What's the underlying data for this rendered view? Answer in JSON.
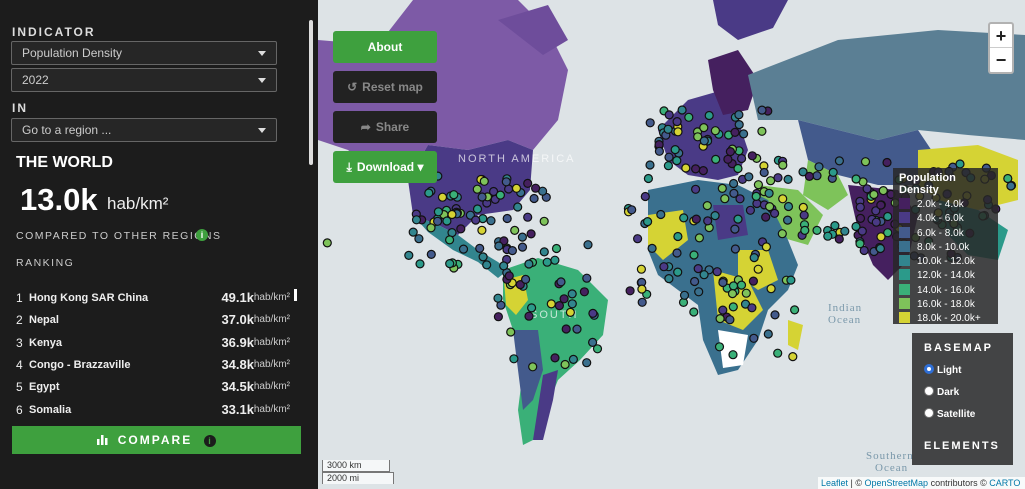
{
  "sidebar": {
    "indicator_label": "INDICATOR",
    "indicator_value": "Population Density",
    "year_value": "2022",
    "in_label": "IN",
    "region_value": "Go to a region ...",
    "region_title": "THE WORLD",
    "region_value_number": "13.0k",
    "region_value_unit": "hab/km²",
    "compared_label": "COMPARED TO OTHER REGIONS",
    "ranking_label": "RANKING",
    "ranking": [
      {
        "rank": "1",
        "name": "Hong Kong SAR China",
        "value": "49.1k",
        "unit": "hab/km²"
      },
      {
        "rank": "2",
        "name": "Nepal",
        "value": "37.0k",
        "unit": "hab/km²"
      },
      {
        "rank": "3",
        "name": "Kenya",
        "value": "36.9k",
        "unit": "hab/km²"
      },
      {
        "rank": "4",
        "name": "Congo - Brazzaville",
        "value": "34.8k",
        "unit": "hab/km²"
      },
      {
        "rank": "5",
        "name": "Egypt",
        "value": "34.5k",
        "unit": "hab/km²"
      },
      {
        "rank": "6",
        "name": "Somalia",
        "value": "33.1k",
        "unit": "hab/km²"
      }
    ],
    "compare_label": "COMPARE"
  },
  "map": {
    "buttons": {
      "about": "About",
      "reset": "Reset map",
      "share": "Share",
      "download": "Download"
    },
    "zoom_in": "+",
    "zoom_out": "−",
    "legend": {
      "title": "Population Density",
      "items": [
        {
          "label": "2.0k - 4.0k",
          "color": "#45205f"
        },
        {
          "label": "4.0k - 6.0k",
          "color": "#4a3a86"
        },
        {
          "label": "6.0k - 8.0k",
          "color": "#435a8c"
        },
        {
          "label": "8.0k - 10.0k",
          "color": "#3a708e"
        },
        {
          "label": "10.0k - 12.0k",
          "color": "#32858e"
        },
        {
          "label": "12.0k - 14.0k",
          "color": "#2b9a8a"
        },
        {
          "label": "14.0k - 16.0k",
          "color": "#3ab078"
        },
        {
          "label": "16.0k - 18.0k",
          "color": "#7ec35a"
        },
        {
          "label": "18.0k - 20.0k+",
          "color": "#d5d334"
        }
      ]
    },
    "basemap": {
      "title": "BASEMAP",
      "options": [
        {
          "label": "Light",
          "selected": true
        },
        {
          "label": "Dark",
          "selected": false
        },
        {
          "label": "Satellite",
          "selected": false
        }
      ],
      "elements_title": "ELEMENTS"
    },
    "labels": {
      "north_america": "NORTH AMERICA",
      "south_america": "SOUTH",
      "indian_ocean_1": "Indian",
      "indian_ocean_2": "Ocean",
      "southern_ocean_1": "Southern",
      "southern_ocean_2": "Ocean"
    },
    "scale": {
      "km": "3000 km",
      "mi": "2000 mi"
    },
    "attribution": {
      "leaflet": "Leaflet",
      "sep": " | © ",
      "osm": "OpenStreetMap",
      "contrib": " contributors © ",
      "carto": "CARTO"
    }
  }
}
